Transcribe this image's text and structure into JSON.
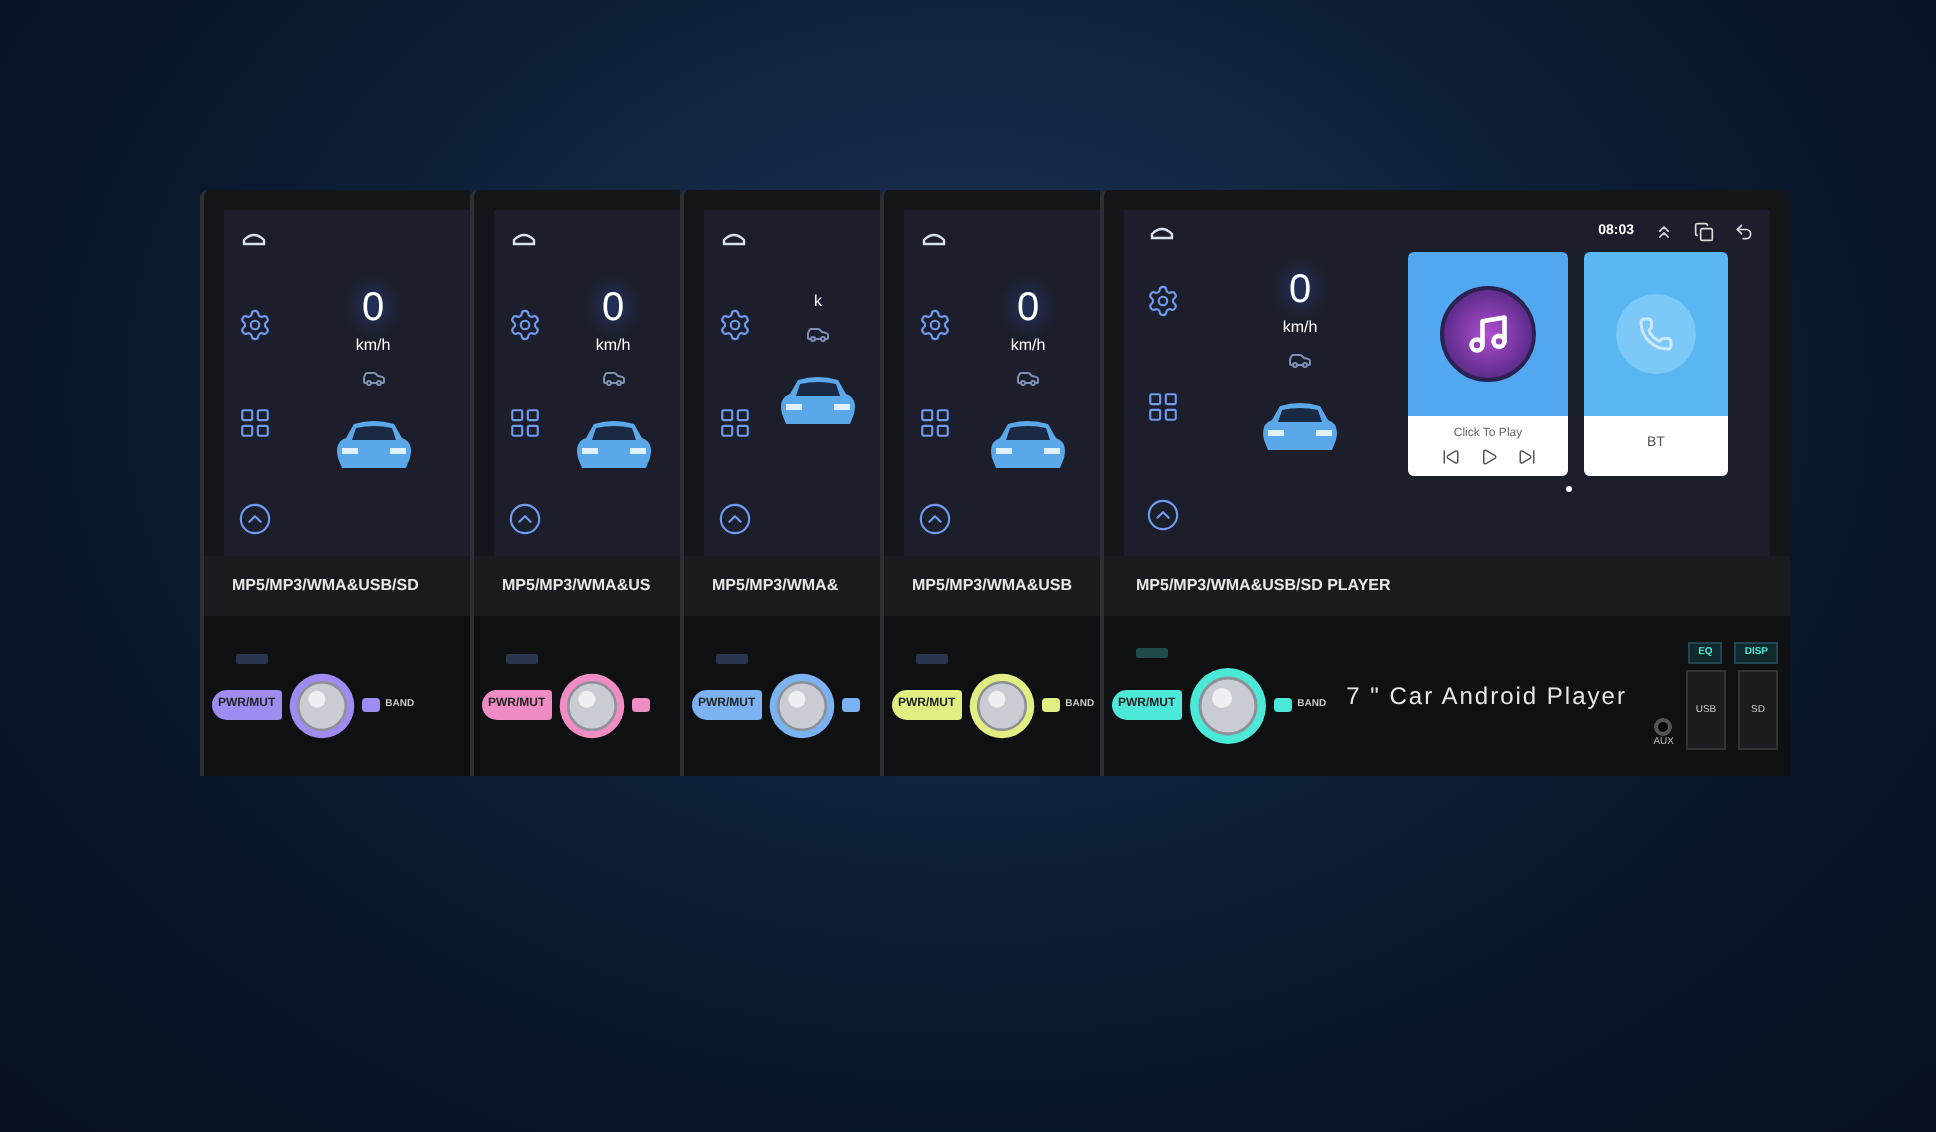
{
  "back_units": [
    {
      "color": "#a08cf0",
      "speed": "0",
      "speed_unit": "km/h",
      "label": "MP5/MP3/WMA&USB/SD",
      "power_label": "PWR/MUT",
      "band_label": "BAND"
    },
    {
      "color": "#f08cc4",
      "speed": "0",
      "speed_unit": "km/h",
      "label": "MP5/MP3/WMA&US",
      "power_label": "PWR/MUT"
    },
    {
      "color": "#7ab2f2",
      "speed_unit": "k",
      "label": "MP5/MP3/WMA&",
      "power_label": "PWR/MUT"
    },
    {
      "color": "#e2ee82",
      "speed": "0",
      "speed_unit": "km/h",
      "label": "MP5/MP3/WMA&USB",
      "power_label": "PWR/MUT",
      "band_label": "BAND"
    }
  ],
  "front_unit": {
    "color": "#4ce8d8",
    "status_time": "08:03",
    "speed": "0",
    "speed_unit": "km/h",
    "cards": [
      {
        "kind": "music",
        "caption": "Click To Play"
      },
      {
        "kind": "phone",
        "caption": "BT"
      }
    ],
    "label": "MP5/MP3/WMA&USB/SD PLAYER",
    "power_label": "PWR/MUT",
    "band_label": "BAND",
    "model": "7 \" Car Android Player",
    "buttons": [
      "EQ",
      "DISP"
    ],
    "slots": [
      "USB",
      "SD"
    ],
    "jack": "AUX"
  }
}
